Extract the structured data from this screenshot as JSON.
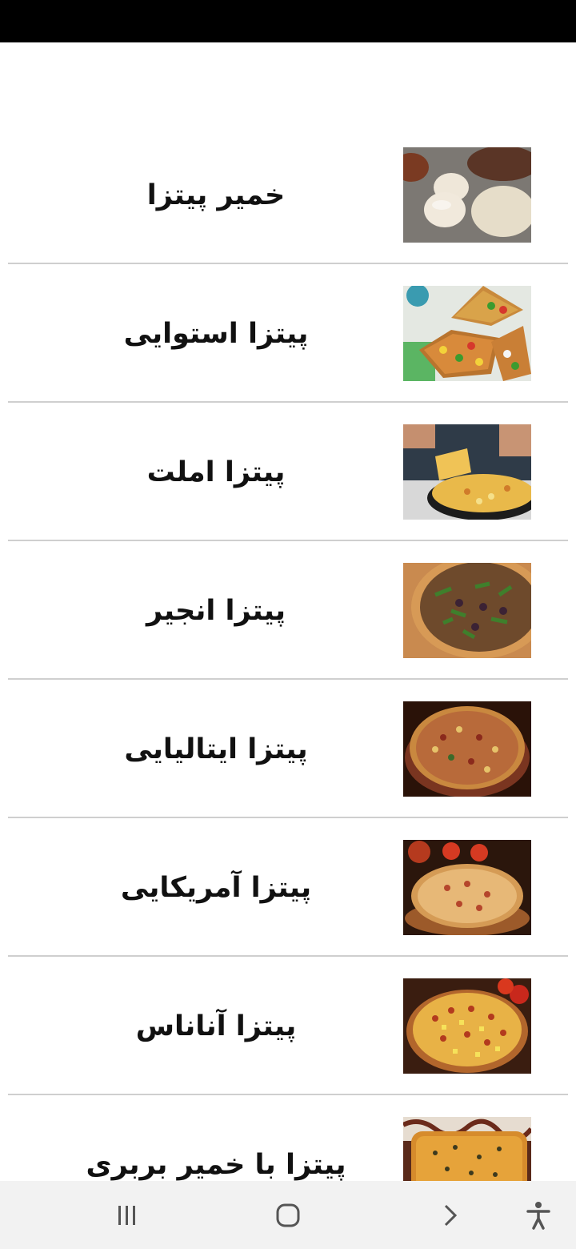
{
  "recipes": [
    {
      "title": "خمیر پیتزا",
      "image_icon": "pizza-dough-photo"
    },
    {
      "title": "پیتزا استوایی",
      "image_icon": "tropical-pizza-photo"
    },
    {
      "title": "پیتزا املت",
      "image_icon": "omelette-pizza-photo"
    },
    {
      "title": "پیتزا انجیر",
      "image_icon": "fig-pizza-photo"
    },
    {
      "title": "پیتزا ایتالیایی",
      "image_icon": "italian-pizza-photo"
    },
    {
      "title": "پیتزا آمریکایی",
      "image_icon": "american-pizza-photo"
    },
    {
      "title": "پیتزا آناناس",
      "image_icon": "pineapple-pizza-photo"
    },
    {
      "title": "پیتزا با خمیر بربری",
      "image_icon": "barbari-pizza-photo"
    }
  ],
  "nav": {
    "recent_apps_icon": "recent-apps-icon",
    "home_icon": "home-icon",
    "back_icon": "back-icon",
    "accessibility_icon": "accessibility-icon"
  },
  "colors": {
    "status_bar": "#000000",
    "background": "#ffffff",
    "divider": "#cfcfcf",
    "nav_bar": "#f2f2f2",
    "nav_icon": "#555555"
  }
}
